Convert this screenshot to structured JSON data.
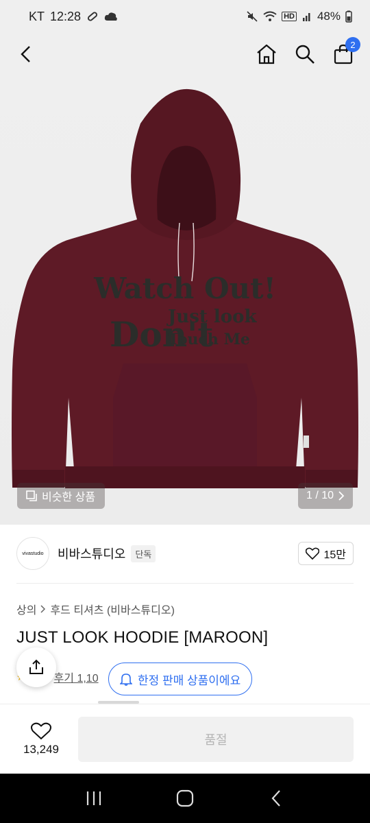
{
  "status_bar": {
    "carrier": "KT",
    "time": "12:28",
    "network": "HD",
    "battery": "48%"
  },
  "header": {
    "back_icon": "back-arrow-icon",
    "home_icon": "home-icon",
    "search_icon": "search-icon",
    "cart_icon": "shopping-bag-icon",
    "cart_count": "2"
  },
  "hero": {
    "print_line1": "Watch Out!",
    "print_line2": "Don't",
    "print_line3": "Just look",
    "print_line4": "Touch Me",
    "similar_label": "비슷한 상품",
    "pager": "1 / 10"
  },
  "brand": {
    "logo_text": "vivastudio",
    "name": "비바스튜디오",
    "tag": "단독",
    "likes": "15만"
  },
  "breadcrumb": {
    "items": [
      "상의",
      "후드 티셔츠 (비바스튜디오)"
    ]
  },
  "product": {
    "title": "JUST LOOK HOODIE [MAROON]",
    "review_text": "후기 1,10"
  },
  "toast": {
    "label": "한정 판매 상품이에요"
  },
  "bottom": {
    "wish_count": "13,249",
    "buy_label": "품절"
  },
  "colors": {
    "accent": "#2f6ff0",
    "hoodie": "#5e1a26",
    "print": "#2b2d2a"
  }
}
